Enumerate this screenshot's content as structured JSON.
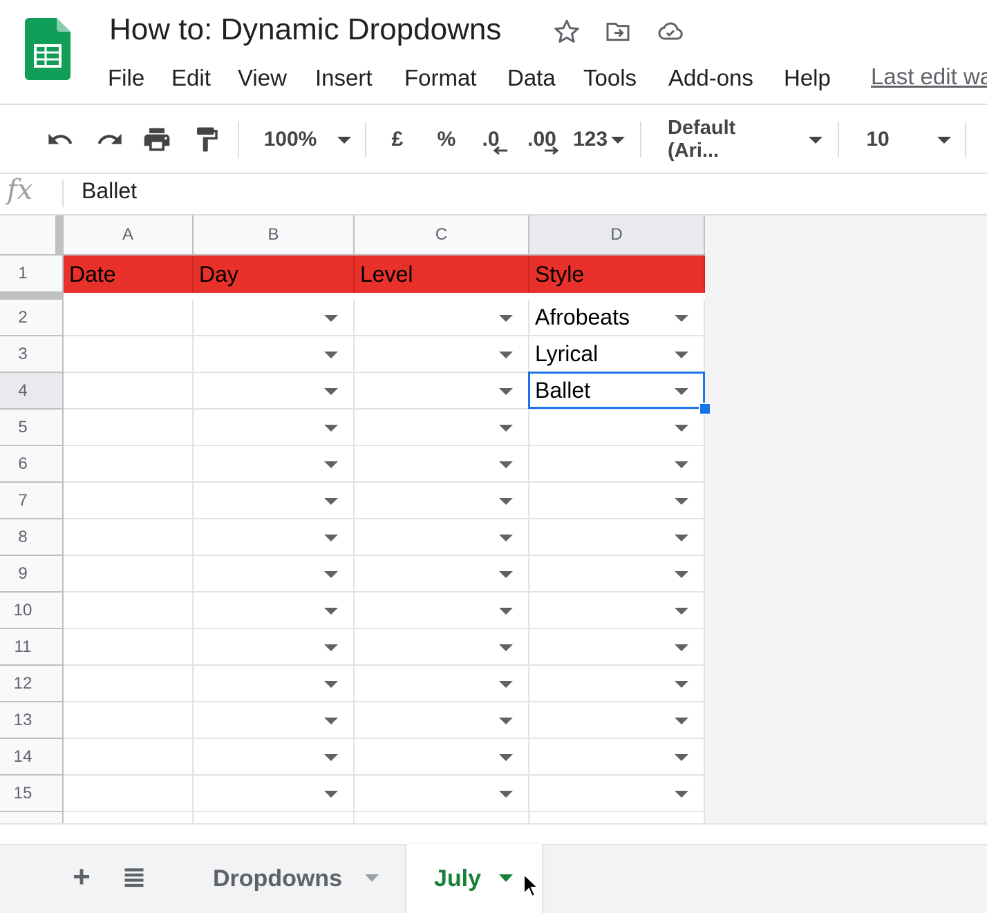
{
  "app": {
    "title": "How to: Dynamic Dropdowns",
    "last_edit": "Last edit was",
    "menu": [
      "File",
      "Edit",
      "View",
      "Insert",
      "Format",
      "Data",
      "Tools",
      "Add-ons",
      "Help"
    ]
  },
  "toolbar": {
    "zoom": "100%",
    "currency": "£",
    "percent": "%",
    "decrease_decimal": ".0",
    "increase_decimal": ".00",
    "more_formats": "123",
    "font": "Default (Ari...",
    "font_size": "10"
  },
  "formula_bar": {
    "fx": "fx",
    "value": "Ballet"
  },
  "columns": [
    "A",
    "B",
    "C",
    "D"
  ],
  "selected_column": "D",
  "selected_row": "4",
  "rows": [
    "1",
    "2",
    "3",
    "4",
    "5",
    "6",
    "7",
    "8",
    "9",
    "10",
    "11",
    "12",
    "13",
    "14",
    "15"
  ],
  "header_row": {
    "A": "Date",
    "B": "Day",
    "C": "Level",
    "D": "Style"
  },
  "style_values": {
    "2": "Afrobeats",
    "3": "Lyrical",
    "4": "Ballet"
  },
  "sheets": {
    "tabs": [
      "Dropdowns",
      "July"
    ],
    "active": "July"
  },
  "colors": {
    "header_fill": "#e8312a",
    "selection": "#1a73e8",
    "active_tab": "#188038",
    "sheets_green": "#0f9d58"
  }
}
